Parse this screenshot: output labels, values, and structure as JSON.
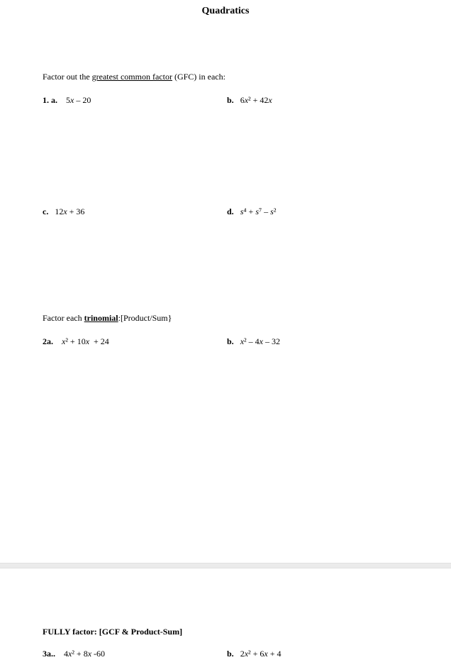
{
  "title": "Quadratics",
  "section1": {
    "instruction_pre": "Factor out the ",
    "instruction_ul": "greatest common factor",
    "instruction_post": " (GFC) in each:",
    "items": {
      "a_label": "1. a.",
      "a_expr": "5x – 20",
      "b_label": "b.",
      "b_expr": "6x² + 42x",
      "c_label": "c.",
      "c_expr": "12x + 36",
      "d_label": "d.",
      "d_expr": "s⁴ + s⁷ – s²"
    }
  },
  "section2": {
    "instruction_pre": "Factor each ",
    "instruction_ul": "trinomial",
    "instruction_post": ":[Product/Sum}",
    "items": {
      "a_label": "2a.",
      "a_expr": "x² + 10x  + 24",
      "b_label": "b.",
      "b_expr": "x² – 4x – 32"
    }
  },
  "section3": {
    "instruction": "FULLY factor:  [GCF & Product-Sum]",
    "items": {
      "a_label": "3a..",
      "a_expr": "4x² + 8x -60",
      "b_label": "b.",
      "b_expr": "2x² + 6x + 4"
    }
  }
}
